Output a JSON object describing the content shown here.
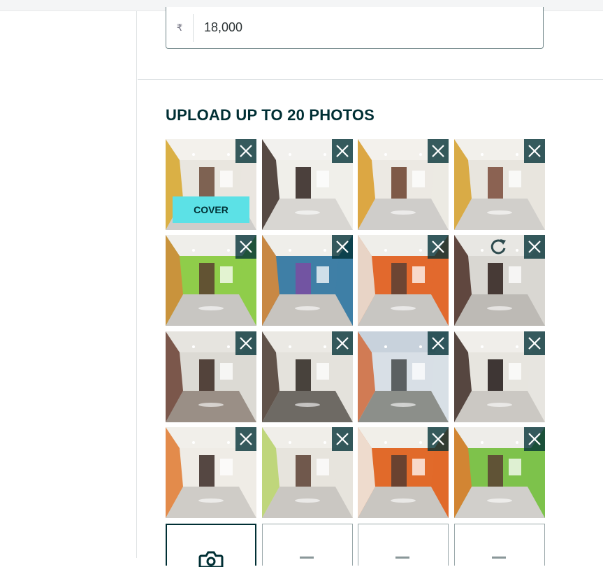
{
  "price": {
    "currency_symbol": "₹",
    "value": "18,000"
  },
  "photos_section": {
    "title": "UPLOAD UP TO 20 PHOTOS",
    "cover_label": "COVER",
    "photos": [
      {
        "name": "photo-1",
        "theme": "hall-yellow"
      },
      {
        "name": "photo-2",
        "theme": "door-corridor"
      },
      {
        "name": "photo-3",
        "theme": "hall-yellow-wide"
      },
      {
        "name": "photo-4",
        "theme": "hall-yellow-sofa"
      },
      {
        "name": "photo-5",
        "theme": "room-green"
      },
      {
        "name": "photo-6",
        "theme": "bedroom-blue"
      },
      {
        "name": "photo-7",
        "theme": "room-orange"
      },
      {
        "name": "photo-8",
        "theme": "kitchen-dark"
      },
      {
        "name": "photo-9",
        "theme": "bathroom"
      },
      {
        "name": "photo-10",
        "theme": "balcony-grille"
      },
      {
        "name": "photo-11",
        "theme": "buildings-outside"
      },
      {
        "name": "photo-12",
        "theme": "kitchen-counter"
      },
      {
        "name": "photo-13",
        "theme": "corridor-orange"
      },
      {
        "name": "photo-14",
        "theme": "room-window"
      },
      {
        "name": "photo-15",
        "theme": "room-orange-2"
      },
      {
        "name": "photo-16",
        "theme": "room-green-2"
      }
    ],
    "icons": {
      "remove": "close-icon",
      "rotate": "rotate-icon",
      "camera": "camera-icon"
    }
  },
  "colors": {
    "brand_dark": "#002f34",
    "cover_accent": "#5ce1e6"
  }
}
